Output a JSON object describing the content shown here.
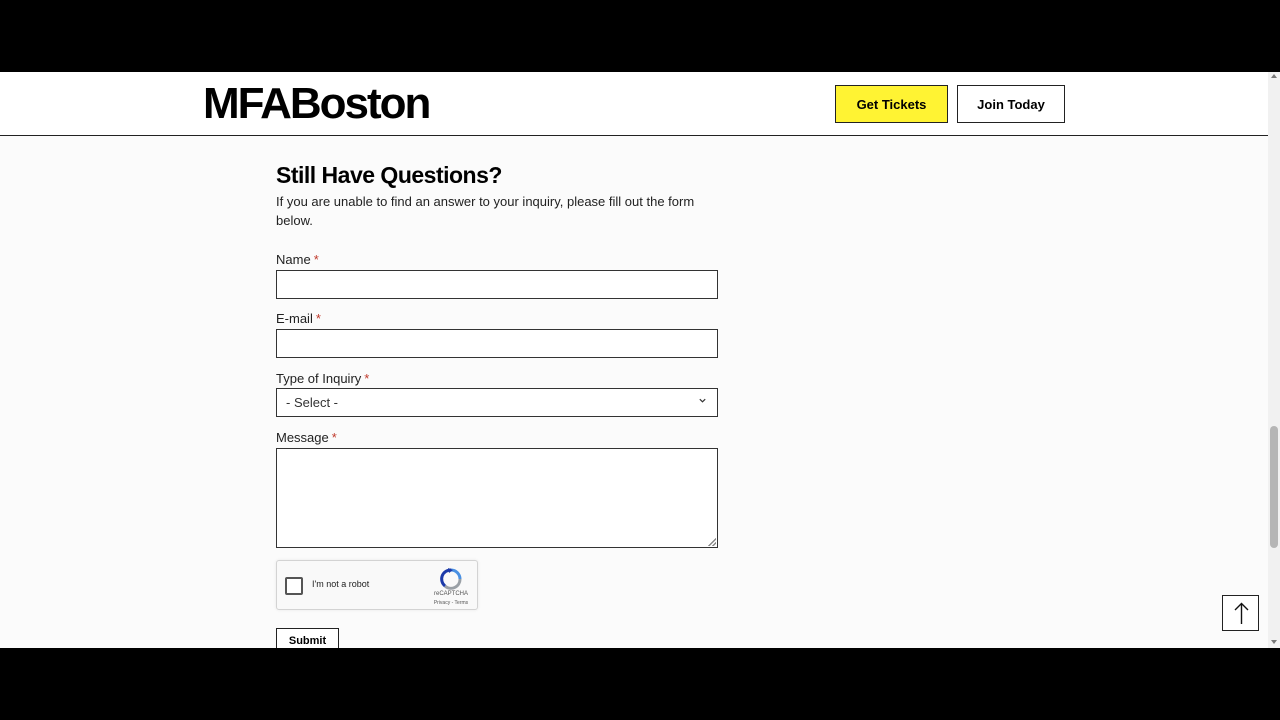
{
  "header": {
    "logo_text": "MFABoston",
    "get_tickets_label": "Get Tickets",
    "join_today_label": "Join Today"
  },
  "form": {
    "heading": "Still Have Questions?",
    "intro": "If you are unable to find an answer to your inquiry, please fill out the form below.",
    "required_mark": "*",
    "name_label": "Name",
    "name_value": "",
    "email_label": "E-mail",
    "email_value": "",
    "inquiry_label": "Type of Inquiry",
    "inquiry_selected": "- Select -",
    "message_label": "Message",
    "message_value": "",
    "submit_label": "Submit"
  },
  "recaptcha": {
    "checkbox_label": "I'm not a robot",
    "brand": "reCAPTCHA",
    "terms": "Privacy - Terms"
  },
  "icons": {
    "back_to_top": "arrow-up-icon",
    "select_chevron": "chevron-down-icon"
  },
  "colors": {
    "accent_yellow": "#fff333",
    "required_red": "#c0392b"
  }
}
